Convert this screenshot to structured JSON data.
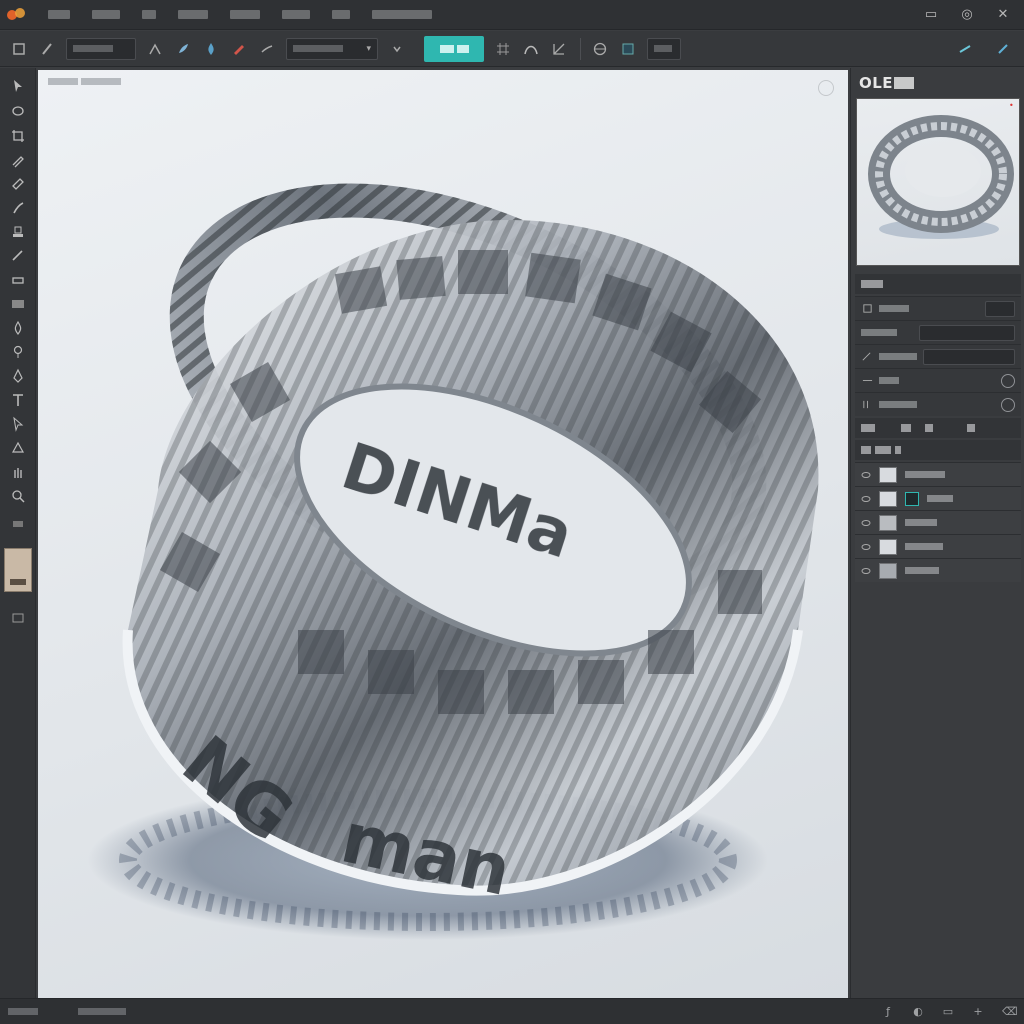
{
  "app": {
    "logo_icon": "app-logo-icon",
    "accent_color": "#2fb7b0",
    "window_controls": [
      "minimize-icon",
      "restore-icon",
      "close-icon"
    ]
  },
  "panel": {
    "title": "OLE"
  },
  "colors": {
    "canvas_bg": "#e6eaee",
    "ring_metal": "#b9bec5",
    "ui_dark": "#3b3d40",
    "accent": "#2fb7b0"
  },
  "render": {
    "ring_lettering": [
      "DINMa",
      "NG",
      "man"
    ]
  }
}
